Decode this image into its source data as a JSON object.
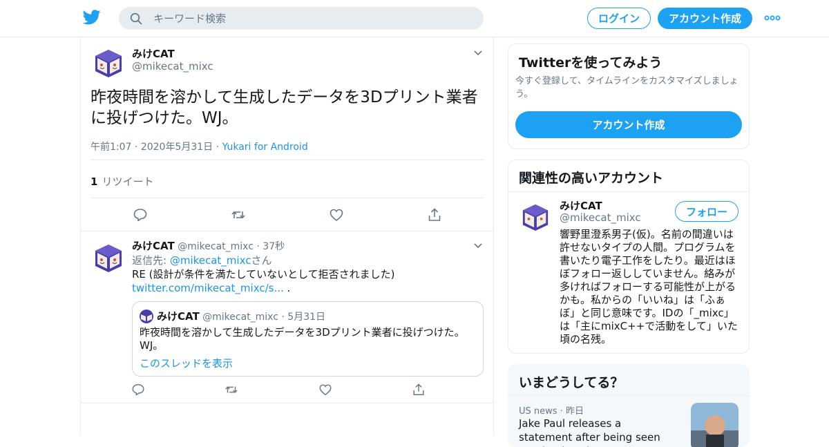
{
  "header": {
    "search_placeholder": "キーワード検索",
    "login_label": "ログイン",
    "signup_label": "アカウント作成",
    "brand_color": "#1da1f2"
  },
  "focused_tweet": {
    "display_name": "みけCAT",
    "handle": "@mikecat_mixc",
    "text": "昨夜時間を溶かして生成したデータを3Dプリント業者に投げつけた。WJ。",
    "time": "午前1:07",
    "date": "2020年5月31日",
    "source": "Yukari for Android",
    "retweet_count": "1",
    "retweet_label": "リツイート"
  },
  "reply_tweet": {
    "display_name": "みけCAT",
    "handle": "@mikecat_mixc",
    "age": "37秒",
    "reply_to_prefix": "返信先: ",
    "reply_to_handle": "@mikecat_mixc",
    "reply_to_suffix": "さん",
    "text": "RE (設計が条件を満たしていないとして拒否されました)",
    "link": "twitter.com/mikecat_mixc/s...",
    "link_suffix": " .",
    "quote": {
      "display_name": "みけCAT",
      "handle": "@mikecat_mixc",
      "date": "5月31日",
      "text": "昨夜時間を溶かして生成したデータを3Dプリント業者に投げつけた。WJ。",
      "thread_link": "このスレッドを表示"
    }
  },
  "sidebar": {
    "signup_card": {
      "title": "Twitterを使ってみよう",
      "description": "今すぐ登録して、タイムラインをカスタマイズしましょう。",
      "button_label": "アカウント作成"
    },
    "related": {
      "title": "関連性の高いアカウント",
      "display_name": "みけCAT",
      "handle": "@mikecat_mixc",
      "follow_label": "フォロー",
      "bio": "響野里澄系男子(仮)。名前の間違いは許せないタイプの人間。プログラムを書いたり電子工作をしたり。最近はほぼフォロー返ししていません。絡みが多ければフォローする可能性が上がるかも。私からの「いいね」は「ふぁぼ」と同じ意味です。IDの「_mixc」は「主にmixC++で活動をして」いた頃の名残。"
    },
    "trends": {
      "title": "いまどうしてる？",
      "item_category": "US news",
      "item_time": "昨日",
      "item_title": "Jake Paul releases a statement after being seen at a looting site"
    }
  }
}
